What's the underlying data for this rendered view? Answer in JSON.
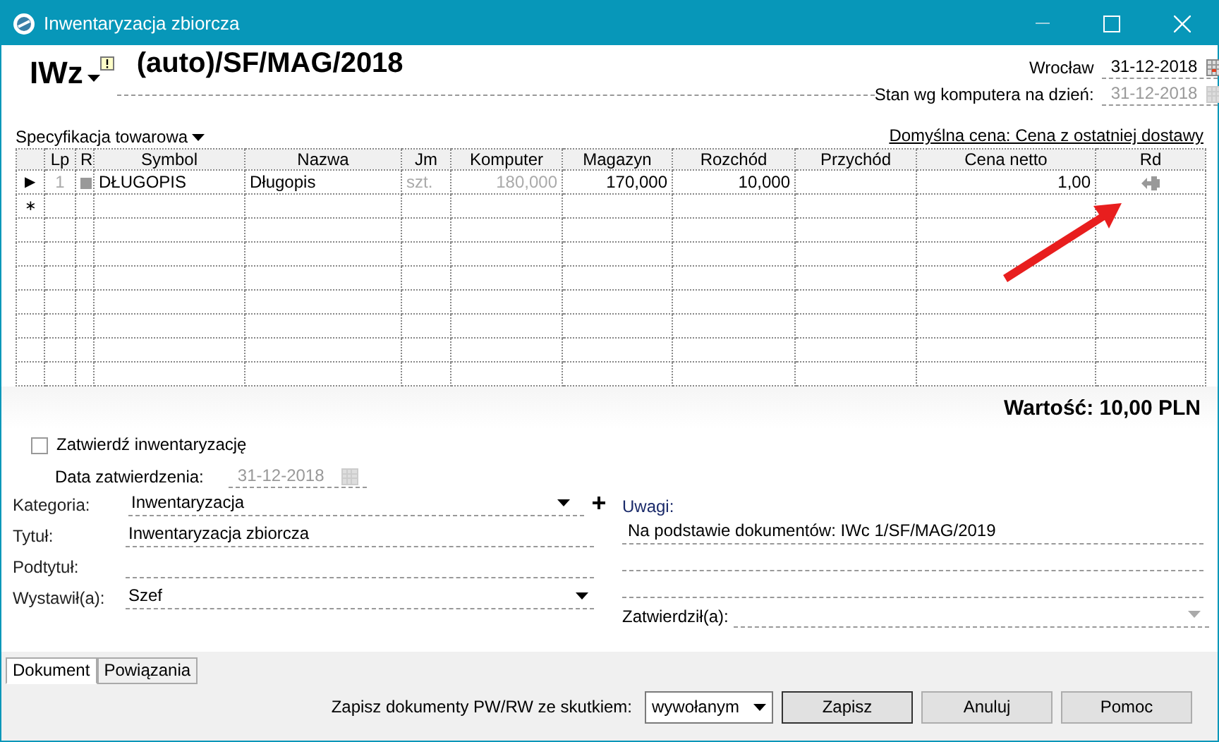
{
  "window": {
    "title": "Inwentaryzacja zbiorcza"
  },
  "header": {
    "doc_type": "IWz",
    "number": "(auto)/SF/MAG/2018",
    "place": "Wrocław",
    "date": "31-12-2018",
    "stock_label": "Stan wg komputera na dzień:",
    "stock_date": "31-12-2018",
    "stock_date_disabled": true
  },
  "grid": {
    "menu": "Specyfikacja towarowa",
    "default_price": "Domyślna cena: Cena z ostatniej dostawy",
    "columns": [
      {
        "muted": false
      },
      {
        "label": "Lp",
        "muted": true
      },
      {
        "label": "R",
        "muted": true
      },
      {
        "label": "Symbol",
        "muted": false
      },
      {
        "label": "Nazwa",
        "muted": false
      },
      {
        "label": "Jm",
        "muted": true
      },
      {
        "label": "Komputer",
        "muted": true
      },
      {
        "label": "Magazyn",
        "muted": false
      },
      {
        "label": "Rozchód",
        "muted": false
      },
      {
        "label": "Przychód"
      },
      {
        "label": "Cena netto",
        "muted": false
      },
      {
        "label": "Rd",
        "muted": true
      }
    ],
    "rows": [
      {
        "indicator": "▶",
        "lp": "1",
        "symbol": "DŁUGOPIS",
        "name": "Długopis",
        "unit": "szt.",
        "computer": "180,000",
        "stock": "170,000",
        "out": "10,000",
        "price": "1,00"
      },
      {
        "indicator": "∗"
      }
    ]
  },
  "total": "Wartość: 10,00 PLN",
  "confirm": {
    "label": "Zatwierdź inwentaryzację",
    "checked": false,
    "date_label": "Data zatwierdzenia:",
    "date": "31-12-2018",
    "disabled": true
  },
  "fields": [
    {
      "label": "Kategoria:",
      "value": "Inwentaryzacja",
      "kind": "dropdown",
      "add": true
    },
    {
      "label": "Tytuł:",
      "value": "Inwentaryzacja zbiorcza",
      "kind": "text"
    },
    {
      "label": "Podtytuł:",
      "kind": "text"
    },
    {
      "label": "Wystawił(a):",
      "value": "Szef",
      "kind": "dropdown"
    }
  ],
  "notes": {
    "label": "Uwagi:",
    "lines": [
      "Na podstawie dokumentów: IWc 1/SF/MAG/2019"
    ]
  },
  "approved_by": {
    "label": "Zatwierdził(a):",
    "disabled": true
  },
  "tabs": [
    {
      "label": "Dokument",
      "selected": true
    },
    {
      "label": "Powiązania",
      "selected": false
    }
  ],
  "footer": {
    "label": "Zapisz dokumenty PW/RW ze skutkiem:",
    "mode": "wywołanym",
    "buttons": [
      "Zapisz",
      "Anuluj",
      "Pomoc"
    ]
  }
}
